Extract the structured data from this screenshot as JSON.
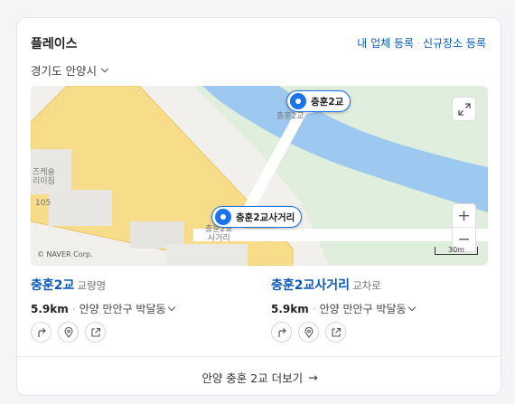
{
  "header": {
    "title": "플레이스",
    "register_label": "내 업체 등록",
    "separator": "·",
    "new_place_label": "신규장소 등록",
    "link_color": "#0b5ab7"
  },
  "region": {
    "label": "경기도 안양시"
  },
  "map": {
    "pins": [
      {
        "label": "충훈2교"
      },
      {
        "label": "충훈2교사거리"
      }
    ],
    "labels": {
      "bridge": "충훈2교",
      "intersection": "충훈2교\n사거리",
      "building": "즈케슬\n리이짐",
      "number": "105"
    },
    "copyright": "© NAVER Corp.",
    "scale": "30m",
    "zoom_in": "+",
    "zoom_out": "−",
    "expand_icon": "expand-icon"
  },
  "places": [
    {
      "name": "충훈2교",
      "category": "교량명",
      "distance": "5.9km",
      "address": "안양 만안구 박달동"
    },
    {
      "name": "충훈2교사거리",
      "category": "교차로",
      "distance": "5.9km",
      "address": "안양 만안구 박달동"
    }
  ],
  "footer": {
    "more_label": "안양 충훈 2교 더보기",
    "arrow": "→"
  }
}
